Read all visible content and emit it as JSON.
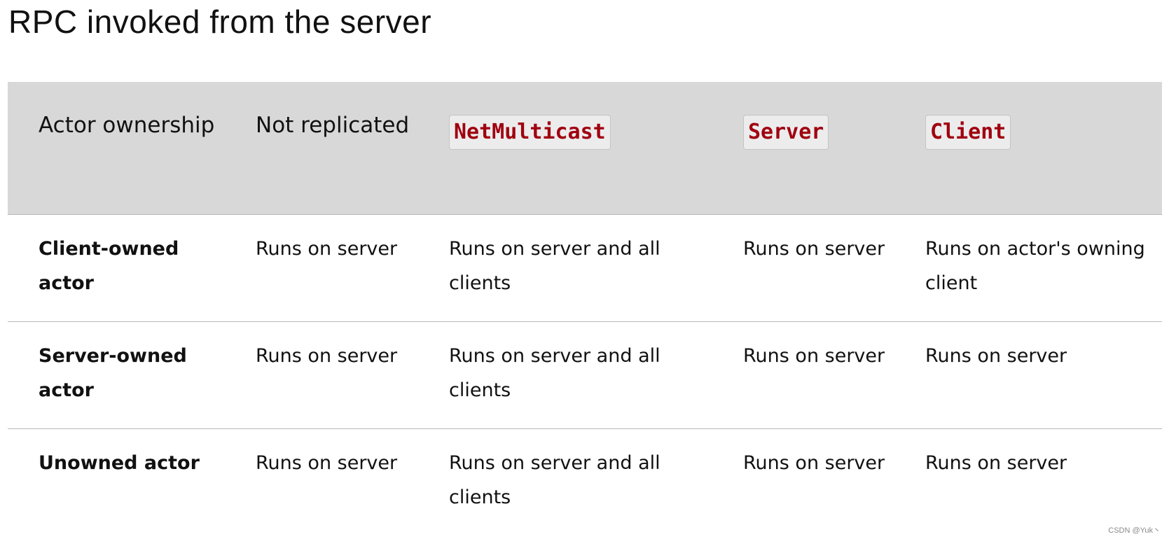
{
  "page": {
    "title": "RPC invoked from the server"
  },
  "table": {
    "headers": {
      "ownership": "Actor ownership",
      "not_replicated": "Not replicated",
      "netmulticast": "NetMulticast",
      "server": "Server",
      "client": "Client"
    },
    "rows": [
      {
        "ownership": "Client-owned actor",
        "not_replicated": "Runs on server",
        "netmulticast": "Runs on server and all clients",
        "server": "Runs on server",
        "client": "Runs on actor's owning client"
      },
      {
        "ownership": "Server-owned actor",
        "not_replicated": "Runs on server",
        "netmulticast": "Runs on server and all clients",
        "server": "Runs on server",
        "client": "Runs on server"
      },
      {
        "ownership": "Unowned actor",
        "not_replicated": "Runs on server",
        "netmulticast": "Runs on server and all clients",
        "server": "Runs on server",
        "client": "Runs on server"
      }
    ]
  },
  "watermark": "CSDN @Yuk丶",
  "colors": {
    "header_bg": "#d8d8d8",
    "code_text": "#a00010",
    "code_bg": "#ececec",
    "row_divider": "#b8b8b8"
  }
}
